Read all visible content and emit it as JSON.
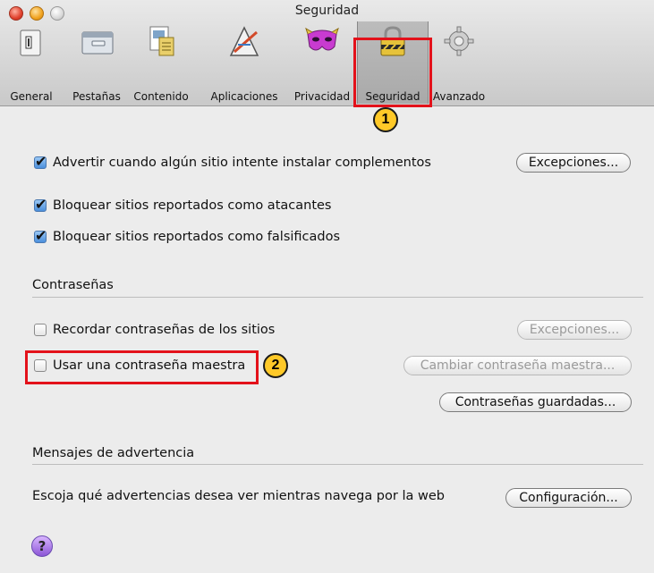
{
  "window": {
    "title": "Seguridad"
  },
  "toolbar": {
    "items": [
      {
        "label": "General",
        "icon": "general-icon"
      },
      {
        "label": "Pestañas",
        "icon": "tabs-icon"
      },
      {
        "label": "Contenido",
        "icon": "content-icon"
      },
      {
        "label": "Aplicaciones",
        "icon": "applications-icon"
      },
      {
        "label": "Privacidad",
        "icon": "privacy-mask-icon"
      },
      {
        "label": "Seguridad",
        "icon": "padlock-icon",
        "selected": true
      },
      {
        "label": "Avanzado",
        "icon": "gear-icon"
      }
    ]
  },
  "annotations": {
    "badge1": "1",
    "badge2": "2"
  },
  "security": {
    "warn_addons": {
      "label": "Advertir cuando algún sitio intente instalar complementos",
      "checked": true
    },
    "block_attack": {
      "label": "Bloquear sitios reportados como atacantes",
      "checked": true
    },
    "block_forgery": {
      "label": "Bloquear sitios reportados como falsificados",
      "checked": true
    },
    "exceptions_label": "Excepciones..."
  },
  "passwords": {
    "section_title": "Contraseñas",
    "remember": {
      "label": "Recordar contraseñas de los sitios",
      "checked": false
    },
    "master": {
      "label": "Usar una contraseña maestra",
      "checked": false
    },
    "exceptions_label": "Excepciones...",
    "change_master_label": "Cambiar contraseña maestra...",
    "saved_label": "Contraseñas guardadas..."
  },
  "warnings": {
    "section_title": "Mensajes de advertencia",
    "description": "Escoja qué advertencias desea ver mientras navega por la web",
    "settings_label": "Configuración..."
  },
  "help": {
    "glyph": "?"
  },
  "colors": {
    "highlight": "#e3111a",
    "badge": "#ffc928"
  }
}
